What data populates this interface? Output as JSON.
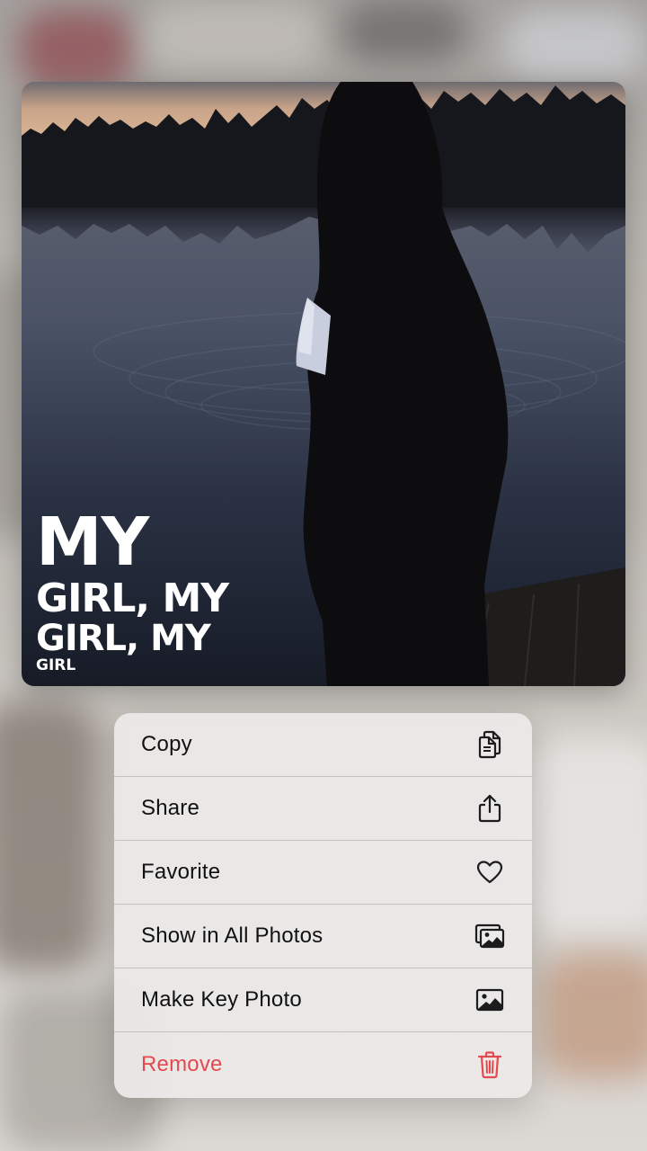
{
  "photo": {
    "overlay_lines": [
      "MY",
      "GIRL, MY",
      "GIRL, MY",
      "GIRL"
    ]
  },
  "menu": {
    "items": [
      {
        "label": "Copy",
        "icon": "copy-icon"
      },
      {
        "label": "Share",
        "icon": "share-icon"
      },
      {
        "label": "Favorite",
        "icon": "heart-icon"
      },
      {
        "label": "Show in All Photos",
        "icon": "photos-stack-icon"
      },
      {
        "label": "Make Key Photo",
        "icon": "photo-icon"
      },
      {
        "label": "Remove",
        "icon": "trash-icon",
        "destructive": true
      }
    ],
    "destructive_color": "#e5484d"
  }
}
